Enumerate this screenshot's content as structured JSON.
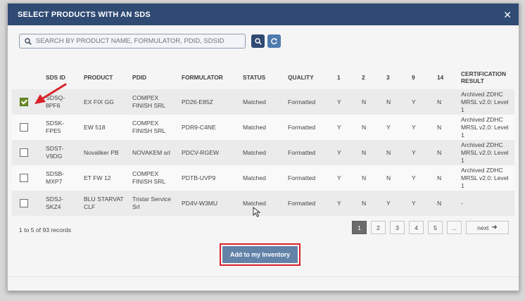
{
  "modal": {
    "title": "SELECT PRODUCTS WITH AN SDS",
    "close_icon": "close-icon"
  },
  "search": {
    "placeholder": "SEARCH BY PRODUCT NAME, FORMULATOR, PDID, SDSID",
    "value": "",
    "search_icon": "search-icon",
    "refresh_icon": "refresh-icon"
  },
  "table": {
    "columns": {
      "sds_id": "SDS ID",
      "product": "PRODUCT",
      "pdid": "PDID",
      "formulator": "FORMULATOR",
      "status": "STATUS",
      "quality": "QUALITY",
      "c1": "1",
      "c2": "2",
      "c3": "3",
      "c9": "9",
      "c14": "14",
      "certification": "CERTIFICATION RESULT"
    },
    "rows": [
      {
        "checked": true,
        "sds_id": "SDSQ-8PF6",
        "product": "EX FIX GG",
        "pdid": "COMPEX FINISH SRL",
        "formulator": "PD26-E85Z",
        "status": "Matched",
        "quality": "Formatted",
        "c1": "Y",
        "c2": "N",
        "c3": "N",
        "c9": "Y",
        "c14": "N",
        "certification": "Archived ZDHC MRSL v2.0: Level 1"
      },
      {
        "checked": false,
        "sds_id": "SDSK-FPE5",
        "product": "EW 518",
        "pdid": "COMPEX FINISH SRL",
        "formulator": "PDR9-C4NE",
        "status": "Matched",
        "quality": "Formatted",
        "c1": "Y",
        "c2": "N",
        "c3": "Y",
        "c9": "Y",
        "c14": "N",
        "certification": "Archived ZDHC MRSL v2.0: Level 1"
      },
      {
        "checked": false,
        "sds_id": "SDST-V9DG",
        "product": "Novaliker PB",
        "pdid": "NOVAKEM srl",
        "formulator": "PDCV-RGEW",
        "status": "Matched",
        "quality": "Formatted",
        "c1": "Y",
        "c2": "N",
        "c3": "N",
        "c9": "Y",
        "c14": "N",
        "certification": "Archived ZDHC MRSL v2.0: Level 1"
      },
      {
        "checked": false,
        "sds_id": "SDSB-MXP7",
        "product": "ET FW 12",
        "pdid": "COMPEX FINISH SRL",
        "formulator": "PDTB-UVP9",
        "status": "Matched",
        "quality": "Formatted",
        "c1": "Y",
        "c2": "N",
        "c3": "N",
        "c9": "Y",
        "c14": "N",
        "certification": "Archived ZDHC MRSL v2.0: Level 1"
      },
      {
        "checked": false,
        "sds_id": "SDSJ-SKZ4",
        "product": "BLU STARVAT CLF",
        "pdid": "Tristar Service Srl",
        "formulator": "PD4V-W3MU",
        "status": "Matched",
        "quality": "Formatted",
        "c1": "Y",
        "c2": "N",
        "c3": "Y",
        "c9": "Y",
        "c14": "N",
        "certification": "-"
      }
    ]
  },
  "footer": {
    "records": "1 to 5 of 93 records",
    "pages": [
      "1",
      "2",
      "3",
      "4",
      "5",
      "..."
    ],
    "active_page": "1",
    "next_label": "next",
    "next_icon": "arrow-right-icon",
    "add_button": "Add to my Inventory"
  },
  "colors": {
    "header_bg": "#2f4a73",
    "accent_blue": "#4f7cae",
    "checkbox_checked": "#6b8e23",
    "highlight_red": "#d8222a",
    "add_button_bg": "#6282a8"
  }
}
